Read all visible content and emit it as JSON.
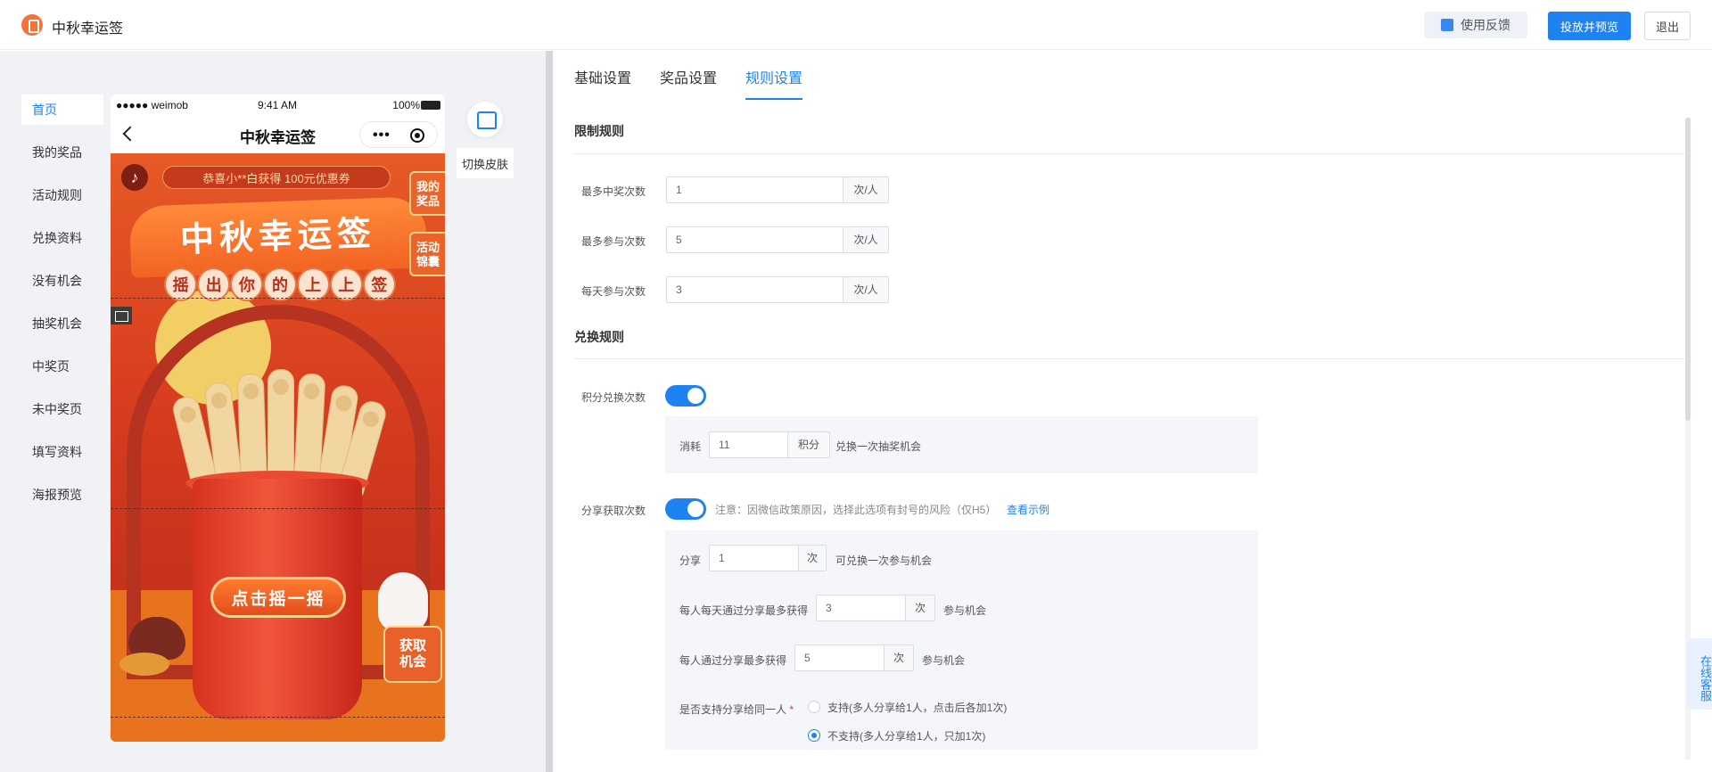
{
  "header": {
    "app_title": "中秋幸运签",
    "feedback_label": "使用反馈",
    "publish_label": "投放并预览",
    "exit_label": "退出"
  },
  "pages": [
    {
      "label": "首页",
      "active": true
    },
    {
      "label": "我的奖品"
    },
    {
      "label": "活动规则"
    },
    {
      "label": "兑换资料"
    },
    {
      "label": "没有机会"
    },
    {
      "label": "抽奖机会"
    },
    {
      "label": "中奖页"
    },
    {
      "label": "未中奖页"
    },
    {
      "label": "填写资料"
    },
    {
      "label": "海报预览"
    }
  ],
  "phone": {
    "status_left": "●●●●● weimob",
    "status_time": "9:41 AM",
    "status_battery": "100%",
    "nav_title": "中秋幸运签",
    "marquee": "恭喜小**白获得 100元优惠券",
    "banner": "中秋幸运签",
    "subtitle_chars": [
      "摇",
      "出",
      "你",
      "的",
      "上",
      "上",
      "签"
    ],
    "tag_prize": "我的\n奖品",
    "tag_bag": "活动\n锦囊",
    "shake_label": "点击摇一摇",
    "get_chance_label": "获取\n机会"
  },
  "skin": {
    "label": "切换皮肤"
  },
  "tabs": [
    {
      "label": "基础设置"
    },
    {
      "label": "奖品设置"
    },
    {
      "label": "规则设置",
      "active": true
    }
  ],
  "limit_rules": {
    "title": "限制规则",
    "max_win_label": "最多中奖次数",
    "max_win_value": "1",
    "max_win_unit": "次/人",
    "max_join_label": "最多参与次数",
    "max_join_value": "5",
    "max_join_unit": "次/人",
    "daily_join_label": "每天参与次数",
    "daily_join_value": "3",
    "daily_join_unit": "次/人"
  },
  "exchange_rules": {
    "title": "兑换规则",
    "points_label": "积分兑换次数",
    "points_enabled": true,
    "consume_label": "消耗",
    "consume_value": "11",
    "consume_unit": "积分",
    "consume_tail": "兑换一次抽奖机会",
    "share_label": "分享获取次数",
    "share_enabled": true,
    "share_note": "注意：因微信政策原因，选择此选项有封号的风险（仅H5）",
    "share_link": "查看示例",
    "share_prefix": "分享",
    "share_value": "1",
    "share_unit": "次",
    "share_tail": "可兑换一次参与机会",
    "daily_share_label": "每人每天通过分享最多获得",
    "daily_share_value": "3",
    "daily_share_unit": "次",
    "daily_share_tail": "参与机会",
    "total_share_label": "每人通过分享最多获得",
    "total_share_value": "5",
    "total_share_unit": "次",
    "total_share_tail": "参与机会",
    "same_person_label": "是否支持分享给同一人",
    "required_mark": "*",
    "option_yes": "支持(多人分享给1人，点击后各加1次)",
    "option_no": "不支持(多人分享给1人，只加1次)",
    "selected_option": "no"
  },
  "service_tab": "在线客服",
  "colors": {
    "accent": "#1f82f1",
    "page_bg": "#f1f2f6"
  }
}
